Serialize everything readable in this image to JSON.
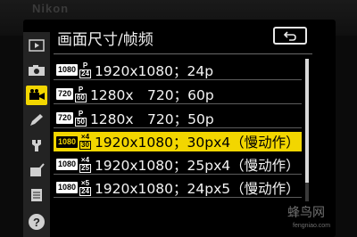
{
  "camera": {
    "brand": "Nikon"
  },
  "menu": {
    "title": "画面尺寸/帧频",
    "back_label": "↩",
    "sidebar": [
      {
        "icon": "playback-icon"
      },
      {
        "icon": "camera-icon"
      },
      {
        "icon": "movie-icon",
        "active": true
      },
      {
        "icon": "pencil-icon"
      },
      {
        "icon": "wrench-icon"
      },
      {
        "icon": "retouch-icon"
      },
      {
        "icon": "my-menu-icon"
      },
      {
        "icon": "help-icon",
        "glyph": "?"
      }
    ],
    "options": [
      {
        "res": "1080",
        "fps_top": "P",
        "fps_bottom": "24",
        "label": "1920x1080；24p",
        "selected": false
      },
      {
        "res": "720",
        "fps_top": "P",
        "fps_bottom": "60",
        "label": "1280x　720；60p",
        "selected": false
      },
      {
        "res": "720",
        "fps_top": "P",
        "fps_bottom": "50",
        "label": "1280x　720；50p",
        "selected": false
      },
      {
        "res": "1080",
        "fps_top": "×4",
        "fps_bottom": "30",
        "label": "1920x1080；30px4（慢动作）",
        "selected": true
      },
      {
        "res": "1080",
        "fps_top": "×4",
        "fps_bottom": "25",
        "label": "1920x1080；25px4（慢动作）",
        "selected": false
      },
      {
        "res": "1080",
        "fps_top": "×5",
        "fps_bottom": "24",
        "label": "1920x1080；24px5（慢动作）",
        "selected": false
      }
    ],
    "scroll_fraction": 0.87
  },
  "watermark": {
    "text": "蜂鸟网",
    "url": "fengniao.com"
  },
  "colors": {
    "highlight": "#f2d600",
    "background": "#000000",
    "text": "#f4f4f4"
  }
}
